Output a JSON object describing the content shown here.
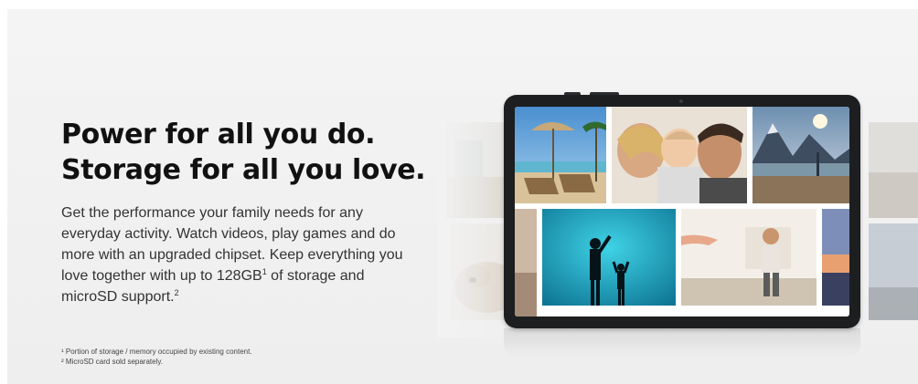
{
  "headline": {
    "line1": "Power for all you do.",
    "line2": "Storage for all you love."
  },
  "body": {
    "part1": "Get the performance your family needs for any everyday activity. Watch videos, play games and do more with an upgraded chipset. Keep everything you love together with up to 128GB",
    "sup1": "1",
    "part2": " of storage and microSD support.",
    "sup2": "2"
  },
  "footnotes": [
    "¹ Portion of storage / memory occupied by existing content.",
    "² MicroSD card sold separately."
  ],
  "colors": {
    "background": "#f2f2f2",
    "headline": "#111111",
    "tablet_frame": "#1d1e20"
  },
  "images": [
    "beach-chairs-photo",
    "family-hug-photo",
    "mountain-lake-photo",
    "aquarium-silhouettes-photo",
    "child-walking-photo",
    "sunset-photo",
    "dog-photo"
  ]
}
